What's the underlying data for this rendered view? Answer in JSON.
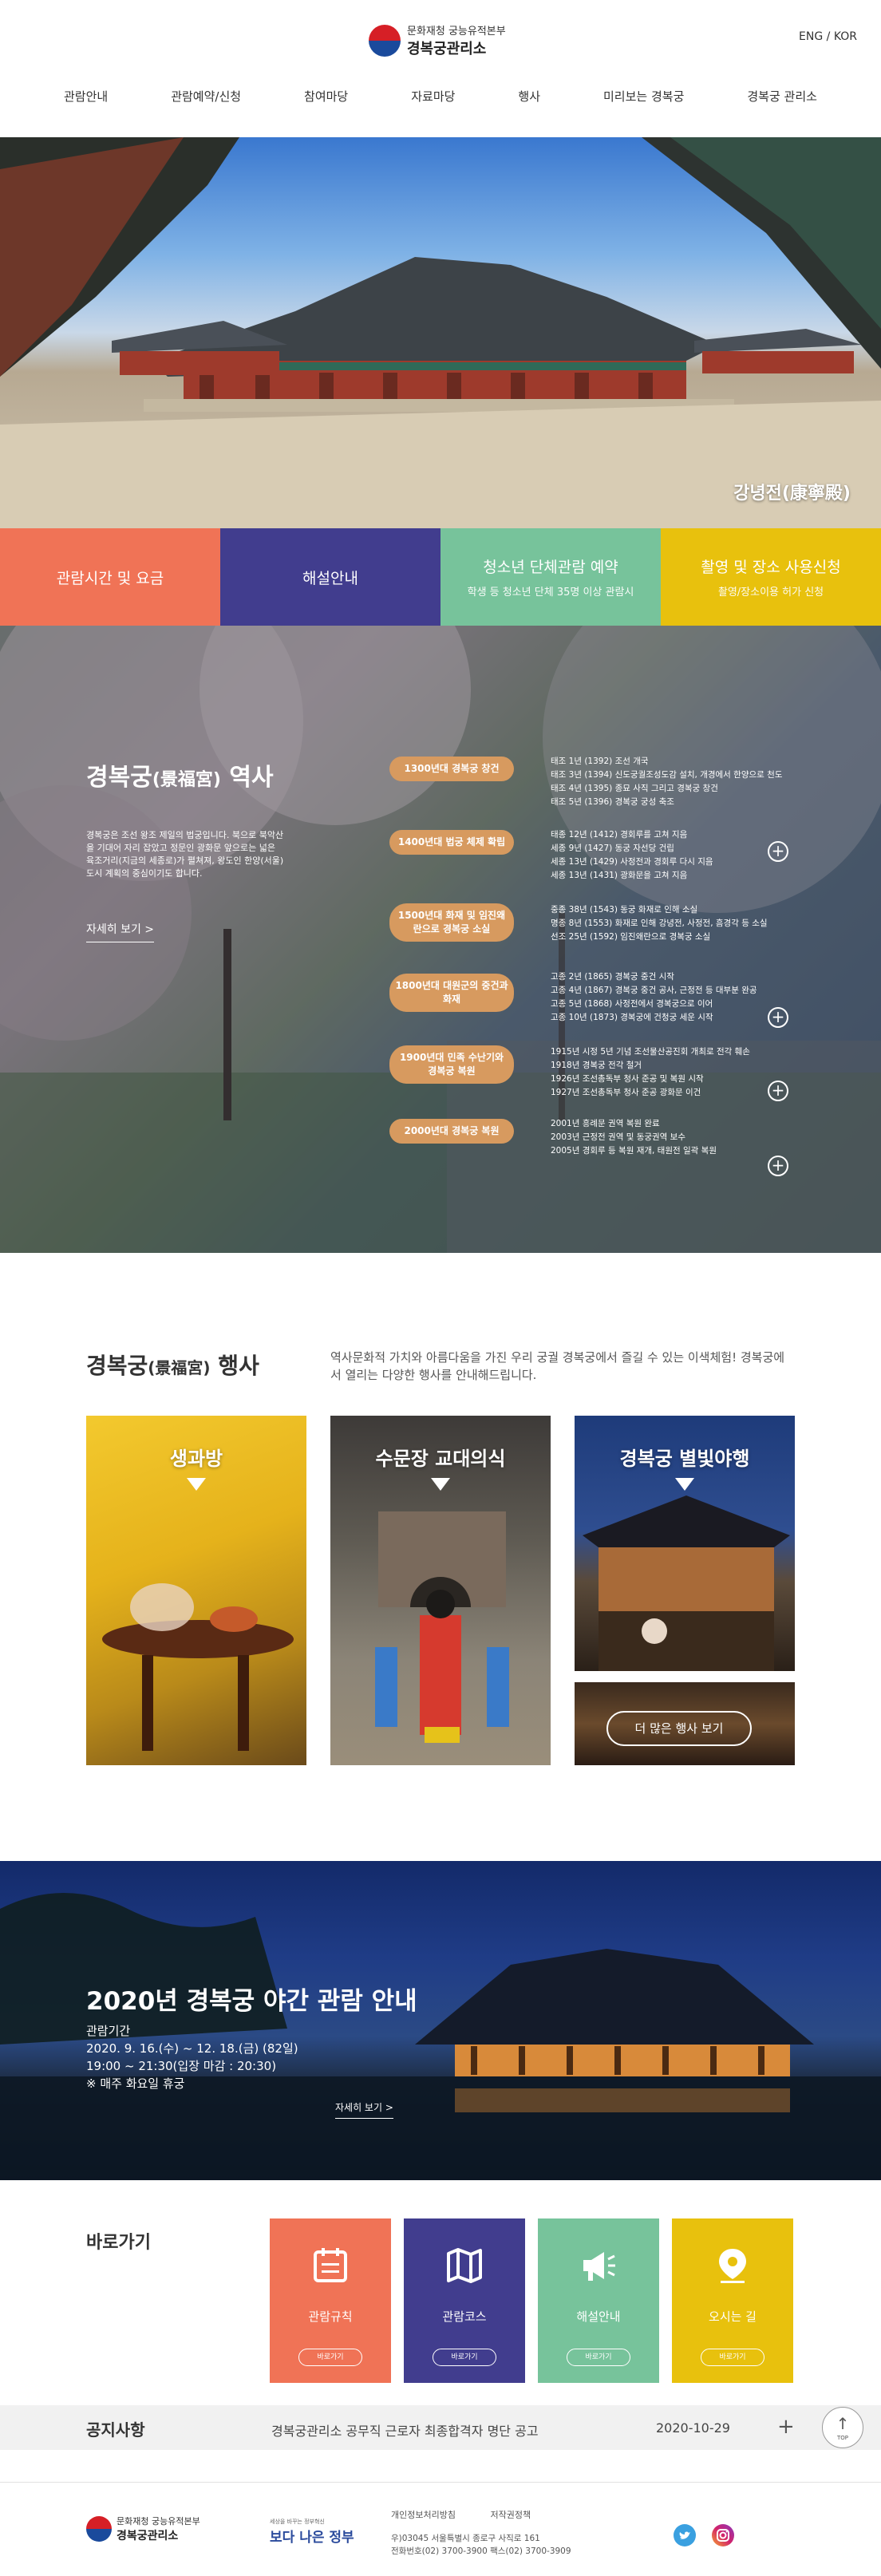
{
  "header": {
    "logo_sub": "문화재청 궁능유적본부",
    "logo_main": "경복궁관리소",
    "lang": "ENG / KOR",
    "nav": [
      "관람안내",
      "관람예약/신청",
      "참여마당",
      "자료마당",
      "행사",
      "미리보는 경복궁",
      "경복궁 관리소"
    ]
  },
  "hero": {
    "caption": "강녕전(康寧殿)"
  },
  "tiles": [
    {
      "title": "관람시간 및 요금",
      "sub": "",
      "color": "#f07356"
    },
    {
      "title": "해설안내",
      "sub": "",
      "color": "#413d8e"
    },
    {
      "title": "청소년 단체관람 예약",
      "sub": "학생 등 청소년 단체 35명 이상 관람시",
      "color": "#77c39b"
    },
    {
      "title": "촬영 및 장소 사용신청",
      "sub": "촬영/장소이용 허가 신청",
      "color": "#e8c10d"
    }
  ],
  "history": {
    "title": "경복궁",
    "title_hanja": "(景福宮)",
    "title_tail": " 역사",
    "desc": "경복궁은 조선 왕조 제일의 법궁입니다. 북으로 북악산을 기대어 자리 잡았고 정문인 광화문 앞으로는 넓은 육조거리(지금의 세종로)가 펼쳐져, 왕도인 한양(서울) 도시 계획의 중심이기도 합니다.",
    "more": "자세히 보기 >",
    "eras": [
      {
        "label": "1300년대 경복궁 창건",
        "lines": [
          "태조 1년 (1392) 조선 개국",
          "태조 3년 (1394) 신도궁궐조성도감 설치, 개경에서 한양으로 천도",
          "태조 4년 (1395) 종묘 사직 그리고 경복궁 창건",
          "태조 5년 (1396) 경복궁 궁성 축조"
        ]
      },
      {
        "label": "1400년대 법궁 체제 확립",
        "lines": [
          "태종 12년 (1412) 경회루를 고쳐 지음",
          "세종 9년 (1427) 동궁 자선당 건립",
          "세종 13년 (1429) 사정전과 경회루 다시 지음",
          "세종 13년 (1431) 광화문을 고쳐 지음"
        ]
      },
      {
        "label": "1500년대 화재 및 임진왜란으로 경복궁 소실",
        "lines": [
          "중종 38년 (1543) 동궁 화재로 인해 소실",
          "명종 8년 (1553) 화재로 인해 강녕전, 사정전, 흠경각 등 소실",
          "선조 25년 (1592) 임진왜란으로 경복궁 소실"
        ]
      },
      {
        "label": "1800년대 대원군의 중건과 화재",
        "lines": [
          "고종 2년 (1865) 경복궁 중건 시작",
          "고종 4년 (1867) 경복궁 중건 공사, 근정전 등 대부분 완공",
          "고종 5년 (1868) 사정전에서 경복궁으로 이어",
          "고종 10년 (1873) 경복궁에 건청궁 세운 시작"
        ]
      },
      {
        "label": "1900년대 민족 수난기와 경복궁 복원",
        "lines": [
          "1915년 시정 5년 기념 조선물산공진회 개최로 전각 훼손",
          "1918년 경복궁 전각 철거",
          "1926년 조선총독부 청사 준공 및 복원 시작",
          "1927년 조선총독부 청사 준공 광화문 이건"
        ]
      },
      {
        "label": "2000년대 경복궁 복원",
        "lines": [
          "2001년 흥례문 권역 복원 완료",
          "2003년 근정전 권역 및 동궁권역 보수",
          "2005년 경회루 등 복원 재개, 태원전 일곽 복원"
        ]
      }
    ]
  },
  "events": {
    "title": "경복궁",
    "title_hanja": "(景福宮)",
    "title_tail": " 행사",
    "desc": "역사문화적 가치와 아름다움을 가진 우리 궁궐 경복궁에서 즐길 수 있는 이색체험! 경복궁에서 열리는 다양한 행사를 안내해드립니다.",
    "cards": [
      "생과방",
      "수문장 교대의식",
      "경복궁 별빛야행"
    ],
    "more": "더 많은 행사 보기"
  },
  "night": {
    "title": "2020년 경복궁 야간 관람 안내",
    "info": [
      "관람기간",
      "2020. 9. 16.(수) ~ 12. 18.(금) (82일)",
      "19:00 ~ 21:30(입장 마감 : 20:30)",
      "※ 매주 화요일 휴궁"
    ],
    "more": "자세히 보기 >"
  },
  "shortcuts": {
    "title": "바로가기",
    "items": [
      {
        "label": "관람규칙",
        "btn": "바로가기",
        "color": "#f07356",
        "icon": "calendar-icon"
      },
      {
        "label": "관람코스",
        "btn": "바로가기",
        "color": "#413d8e",
        "icon": "map-icon"
      },
      {
        "label": "해설안내",
        "btn": "바로가기",
        "color": "#77c39b",
        "icon": "megaphone-icon"
      },
      {
        "label": "오시는 길",
        "btn": "바로가기",
        "color": "#e8c10d",
        "icon": "location-pin-icon"
      }
    ]
  },
  "notice": {
    "label": "공지사항",
    "text": "경복궁관리소 공무직 근로자 최종합격자 명단 공고",
    "date": "2020-10-29",
    "top": "TOP"
  },
  "footer": {
    "logo_sub": "문화재청 궁능유적본부",
    "logo_main": "경복궁관리소",
    "bnj_sub": "세상을 바꾸는 정부혁신",
    "bnj_main": "보다 나은 정부",
    "links": [
      "개인정보처리방침",
      "저작권정책"
    ],
    "addr1": "우)03045 서울특별시 종로구 사직로 161",
    "addr2": "전화번호(02) 3700-3900 팩스(02) 3700-3909"
  }
}
